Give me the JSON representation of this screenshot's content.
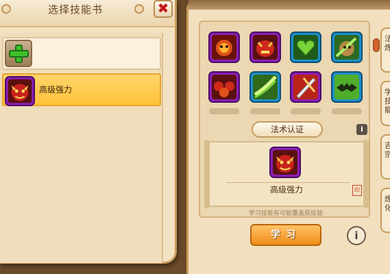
{
  "left_panel": {
    "title": "选择技能书",
    "close_label": "✖",
    "add_row": {
      "icon": "green-plus-icon"
    },
    "skills": [
      {
        "name": "高级强力",
        "icon": "red-beast-power-icon"
      }
    ]
  },
  "right_panel": {
    "grid": [
      {
        "icon": "fire-demon-icon",
        "frame": "purple"
      },
      {
        "icon": "red-monster-icon",
        "frame": "purple"
      },
      {
        "icon": "green-heart-icon",
        "frame": "blue"
      },
      {
        "icon": "green-beast-icon",
        "frame": "blue"
      },
      {
        "icon": "red-split-icon",
        "frame": "purple"
      },
      {
        "icon": "green-slash-icon",
        "frame": "blue"
      },
      {
        "icon": "red-blade-icon",
        "frame": "purple"
      },
      {
        "icon": "green-bat-icon",
        "frame": "blue"
      }
    ],
    "cert_button": "法术认证",
    "info_small": "i",
    "scroll": {
      "skill_name": "高级强力",
      "seal": "印",
      "icon": "red-beast-power-icon"
    },
    "warning": "学习技能有可能覆盖原技能",
    "learn_button": "学习",
    "info_big": "i",
    "side_tabs": [
      "法\n炼",
      "学\n技\n能",
      "吉\n宗",
      "炼\n化"
    ]
  },
  "colors": {
    "purple_frame": "#8a1fb3",
    "blue_frame": "#1d8fc7",
    "selected_row": "#ffc84a",
    "learn_button": "#f59a22"
  }
}
